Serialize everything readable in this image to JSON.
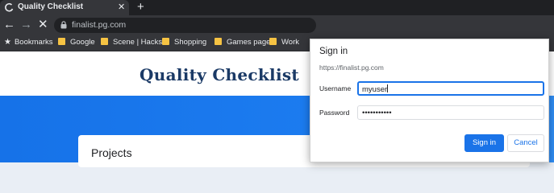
{
  "browser": {
    "tab": {
      "title": "Quality Checklist",
      "close": "✕"
    },
    "new_tab": "+",
    "nav": {
      "back": "←",
      "forward": "→",
      "stop": "✕"
    },
    "omnibox": {
      "url": "finalist.pg.com"
    },
    "bookmarks": [
      {
        "label": "Bookmarks"
      },
      {
        "label": "Google"
      },
      {
        "label": "Scene | Hacks"
      },
      {
        "label": "Shopping"
      },
      {
        "label": "Games page"
      },
      {
        "label": "Work"
      }
    ]
  },
  "page": {
    "title": "Quality Checklist",
    "projects_heading": "Projects"
  },
  "dialog": {
    "title": "Sign in",
    "url": "https://finalist.pg.com",
    "username_label": "Username",
    "username_value": "myuser",
    "password_label": "Password",
    "password_value": "•••••••••••",
    "signin_button": "Sign in",
    "cancel_button": "Cancel"
  },
  "colors": {
    "accent": "#1a73e8",
    "header_title": "#1b3a66",
    "band": "#1672e8",
    "bookmark_folder": "#f6c343"
  }
}
